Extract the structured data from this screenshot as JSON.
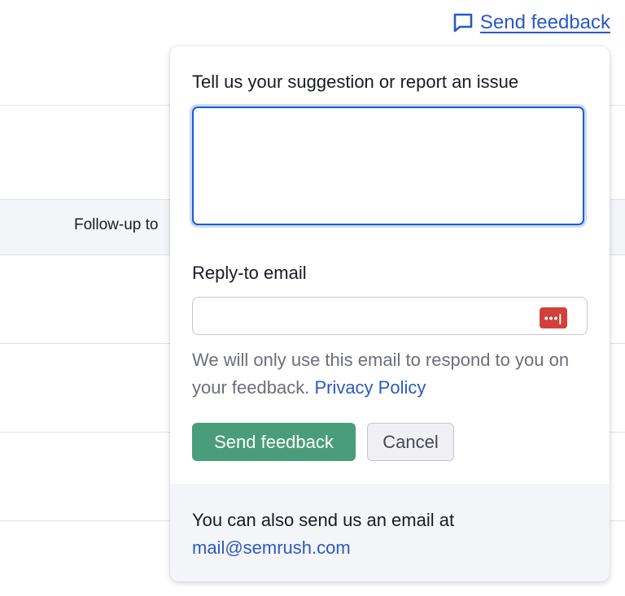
{
  "header": {
    "send_feedback_link": "Send feedback",
    "icon": "speech-bubble-icon"
  },
  "background": {
    "column_header": "Follow-up to"
  },
  "feedback_popover": {
    "heading": "Tell us your suggestion or report an issue",
    "textarea_value": "",
    "email_label": "Reply-to email",
    "email_value": "",
    "password_manager_icon": "•••|",
    "note_text": "We will only use this email to respond to you on your feedback. ",
    "privacy_link": "Privacy Policy",
    "send_button": "Send feedback",
    "cancel_button": "Cancel",
    "footer_text": "You can also send us an email at",
    "footer_email": "mail@semrush.com"
  },
  "colors": {
    "accent_link": "#2b59c3",
    "primary_button": "#4a9d7c",
    "focus_border": "#1a5cd8",
    "password_manager": "#d0413a"
  }
}
